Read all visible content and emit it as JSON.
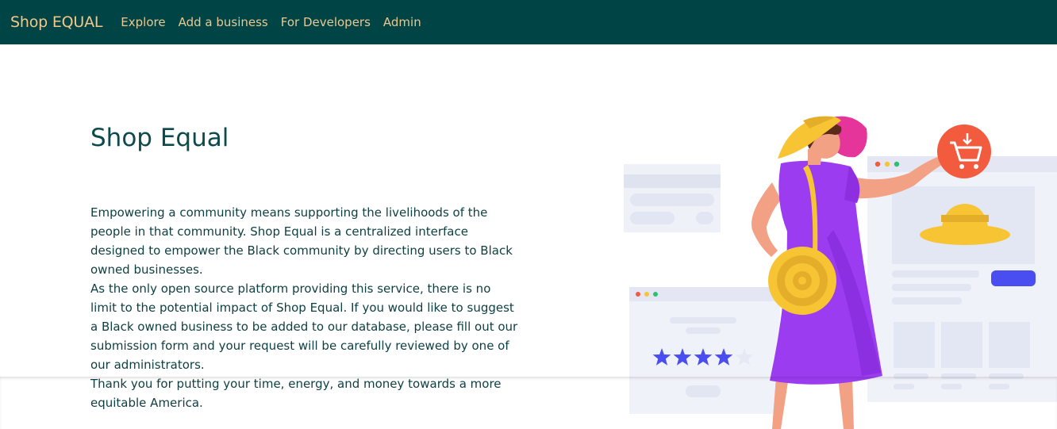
{
  "navbar": {
    "brand": "Shop EQUAL",
    "links": [
      "Explore",
      "Add a business",
      "For Developers",
      "Admin"
    ],
    "background": "#004445",
    "link_color": "#e9c891"
  },
  "hero": {
    "title": "Shop Equal",
    "paragraphs": [
      "Empowering a community means supporting the livelihoods of the people in that community. Shop Equal is a centralized interface designed to empower the Black community by directing users to Black owned businesses.",
      "As the only open source platform providing this service, there is no limit to the potential impact of Shop Equal. If you would like to suggest a Black owned business to be added to our database, please fill out our submission form and your request will be carefully reviewed by one of our administrators.",
      "Thank you for putting your time, energy, and money towards a more equitable America."
    ]
  },
  "illustration": {
    "review_rating": 4,
    "review_max": 5,
    "accent_colors": {
      "cart_badge": "#f25b3e",
      "dress": "#9b3cf0",
      "hat": "#f7c533",
      "stars": "#4a4ef0"
    }
  }
}
